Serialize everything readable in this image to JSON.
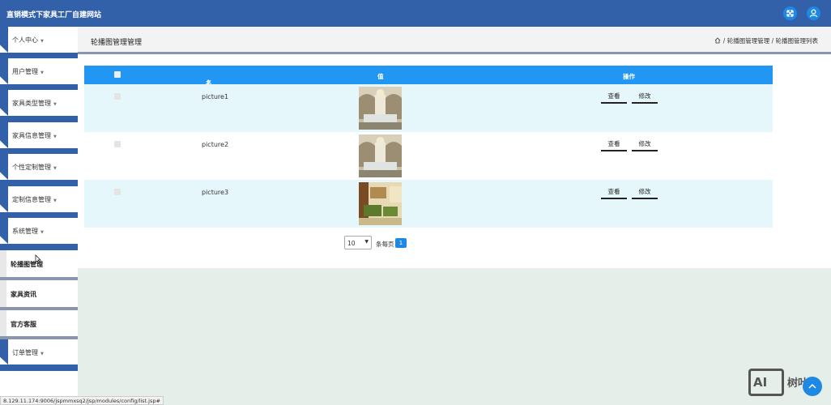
{
  "app": {
    "title": "直销模式下家具工厂自建网站",
    "fullscreen_icon": "expand-icon",
    "user_icon": "user-icon"
  },
  "sidebar": {
    "items": [
      {
        "label": "个人中心",
        "caret": "▼"
      },
      {
        "label": "用户管理",
        "caret": "▼"
      },
      {
        "label": "家具类型管理",
        "caret": "▼"
      },
      {
        "label": "家具信息管理",
        "caret": "▼"
      },
      {
        "label": "个性定制管理",
        "caret": "▼"
      },
      {
        "label": "定制信息管理",
        "caret": "▼"
      },
      {
        "label": "系统管理",
        "caret": "▼"
      }
    ],
    "subitems": [
      {
        "label": "轮播图管理"
      },
      {
        "label": "家具资讯"
      },
      {
        "label": "官方客服"
      }
    ],
    "last_item": {
      "label": "订单管理",
      "caret": "▼"
    }
  },
  "header": {
    "page_title": "轮播图管理管理",
    "breadcrumb": "/ 轮播图管理管理 / 轮播图管理列表",
    "home_icon": "home-icon"
  },
  "table": {
    "columns": [
      "名称",
      "值",
      "操作"
    ],
    "sort_mark": "⇕",
    "rows": [
      {
        "name": "picture1",
        "view": "查看",
        "edit": "修改"
      },
      {
        "name": "picture2",
        "view": "查看",
        "edit": "修改"
      },
      {
        "name": "picture3",
        "view": "查看",
        "edit": "修改"
      }
    ]
  },
  "pagination": {
    "page_size": "10",
    "per_page_label": "条每页",
    "current_page": "1"
  },
  "status_url": "8.129.11.174:9006/jspmmxsq2/jsp/modules/config/list.jsp#",
  "watermark": {
    "logo": "AI",
    "text": "树叶云"
  },
  "colors": {
    "topbar": "#3361a9",
    "table_header": "#2196f3",
    "row_alt": "#e6f7fb",
    "accent": "#1e88e5"
  }
}
